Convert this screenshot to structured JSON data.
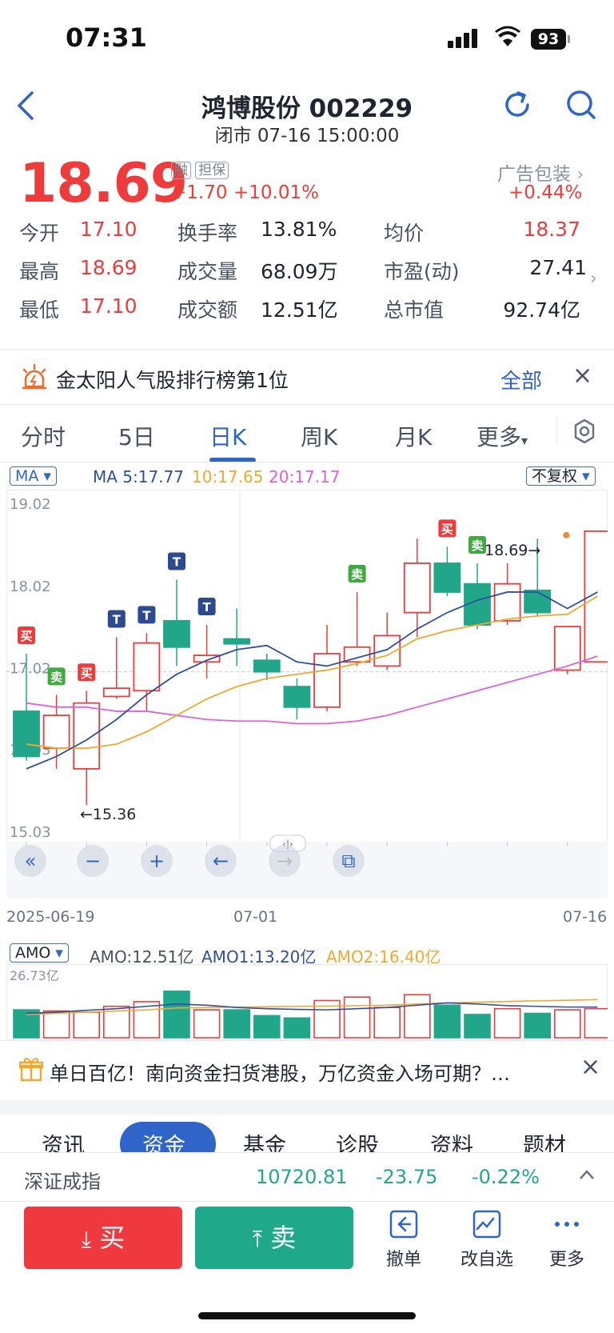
{
  "status": {
    "time": "07:31",
    "battery": "93"
  },
  "header": {
    "title": "鸿博股份 002229",
    "subtitle": "闭市 07-16 15:00:00"
  },
  "quote": {
    "price": "18.69",
    "tags": [
      "融",
      "担保"
    ],
    "change": "+1.70",
    "change_pct": "+10.01%",
    "sector_name": "广告包装",
    "sector_change": "+0.44%"
  },
  "stats": [
    {
      "label": "今开",
      "value": "17.10",
      "color": "#ee3b3b"
    },
    {
      "label": "换手率",
      "value": "13.81%",
      "color": "#1f2430"
    },
    {
      "label": "均价",
      "value": "18.37",
      "color": "#ee3b3b"
    },
    {
      "label": "最高",
      "value": "18.69",
      "color": "#ee3b3b"
    },
    {
      "label": "成交量",
      "value": "68.09万",
      "color": "#1f2430"
    },
    {
      "label": "市盈(动)",
      "value": "27.41",
      "color": "#1f2430"
    },
    {
      "label": "最低",
      "value": "17.10",
      "color": "#ee3b3b"
    },
    {
      "label": "成交额",
      "value": "12.51亿",
      "color": "#1f2430"
    },
    {
      "label": "总市值",
      "value": "92.74亿",
      "color": "#1f2430"
    }
  ],
  "banner": {
    "text": "金太阳人气股排行榜第1位",
    "action": "全部"
  },
  "tabs": [
    "分时",
    "5日",
    "日K",
    "周K",
    "月K",
    "更多"
  ],
  "active_tab": "日K",
  "ma_bar": {
    "selector": "MA",
    "ma5": "MA 5:17.77",
    "ma10": "10:17.65",
    "ma20": "20:17.17",
    "adjust": "不复权",
    "colors": {
      "ma5": "#2f4fa0",
      "ma10": "#f0a830",
      "ma20": "#e060e0"
    }
  },
  "chart_data": {
    "type": "candlestick",
    "y_ticks": [
      "19.02",
      "18.02",
      "17.02",
      "16.03",
      "15.03"
    ],
    "ylim": [
      15.03,
      19.02
    ],
    "x_labels": [
      "2025-06-19",
      "07-01",
      "07-16"
    ],
    "last_price_label": "18.69",
    "low_marker": "15.36",
    "candles": [
      {
        "o": 16.5,
        "c": 15.95,
        "h": 17.2,
        "l": 15.9
      },
      {
        "o": 16.05,
        "c": 16.45,
        "h": 16.7,
        "l": 15.8
      },
      {
        "o": 15.8,
        "c": 16.6,
        "h": 16.75,
        "l": 15.36
      },
      {
        "o": 16.68,
        "c": 16.78,
        "h": 17.4,
        "l": 16.65
      },
      {
        "o": 16.75,
        "c": 17.33,
        "h": 17.45,
        "l": 16.5
      },
      {
        "o": 17.6,
        "c": 17.28,
        "h": 18.1,
        "l": 17.05
      },
      {
        "o": 17.1,
        "c": 17.18,
        "h": 17.55,
        "l": 16.9
      },
      {
        "o": 17.38,
        "c": 17.32,
        "h": 17.75,
        "l": 17.05
      },
      {
        "o": 17.12,
        "c": 16.98,
        "h": 17.2,
        "l": 16.88
      },
      {
        "o": 16.8,
        "c": 16.55,
        "h": 16.9,
        "l": 16.4
      },
      {
        "o": 16.55,
        "c": 17.2,
        "h": 17.55,
        "l": 16.5
      },
      {
        "o": 17.1,
        "c": 17.28,
        "h": 17.95,
        "l": 17.05
      },
      {
        "o": 17.05,
        "c": 17.42,
        "h": 17.7,
        "l": 17.0
      },
      {
        "o": 17.7,
        "c": 18.3,
        "h": 18.6,
        "l": 17.4
      },
      {
        "o": 18.3,
        "c": 17.95,
        "h": 18.5,
        "l": 17.9
      },
      {
        "o": 18.05,
        "c": 17.55,
        "h": 18.3,
        "l": 17.5
      },
      {
        "o": 17.6,
        "c": 18.05,
        "h": 18.3,
        "l": 17.55
      },
      {
        "o": 17.97,
        "c": 17.7,
        "h": 18.6,
        "l": 17.65
      },
      {
        "o": 17.0,
        "c": 17.53,
        "h": 17.45,
        "l": 16.95
      },
      {
        "o": 17.1,
        "c": 18.69,
        "h": 18.69,
        "l": 17.1
      }
    ],
    "signals": [
      {
        "index": 0,
        "label": "买",
        "kind": "buy",
        "pos": "above"
      },
      {
        "index": 1,
        "label": "卖",
        "kind": "sell",
        "pos": "above"
      },
      {
        "index": 2,
        "label": "买",
        "kind": "buy",
        "pos": "above"
      },
      {
        "index": 3,
        "label": "T",
        "kind": "t",
        "pos": "above"
      },
      {
        "index": 4,
        "label": "T",
        "kind": "t",
        "pos": "above"
      },
      {
        "index": 5,
        "label": "T",
        "kind": "t",
        "pos": "above"
      },
      {
        "index": 6,
        "label": "T",
        "kind": "t",
        "pos": "above"
      },
      {
        "index": 11,
        "label": "卖",
        "kind": "sell",
        "pos": "above"
      },
      {
        "index": 14,
        "label": "买",
        "kind": "buy",
        "pos": "above"
      },
      {
        "index": 15,
        "label": "卖",
        "kind": "sell",
        "pos": "above"
      }
    ],
    "ma5": [
      15.8,
      15.95,
      16.15,
      16.4,
      16.7,
      16.95,
      17.12,
      17.25,
      17.3,
      17.1,
      17.05,
      17.15,
      17.25,
      17.5,
      17.7,
      17.85,
      17.95,
      17.95,
      17.75,
      17.95
    ],
    "ma10": [
      16.1,
      16.05,
      16.05,
      16.1,
      16.25,
      16.45,
      16.65,
      16.8,
      16.9,
      16.95,
      17.0,
      17.08,
      17.18,
      17.38,
      17.48,
      17.55,
      17.62,
      17.66,
      17.68,
      17.9
    ],
    "ma20": [
      16.6,
      16.55,
      16.55,
      16.5,
      16.5,
      16.45,
      16.4,
      16.38,
      16.38,
      16.35,
      16.35,
      16.38,
      16.45,
      16.55,
      16.65,
      16.75,
      16.85,
      16.95,
      17.05,
      17.17
    ]
  },
  "amo": {
    "selector": "AMO",
    "amo": "AMO:12.51亿",
    "amo1": "AMO1:13.20亿",
    "amo2": "AMO2:16.40亿",
    "top_label": "26.73亿",
    "volumes": [
      12.0,
      11.5,
      11.0,
      13.5,
      15.5,
      20.0,
      12.0,
      12.0,
      9.5,
      8.5,
      16.0,
      17.5,
      13.0,
      18.5,
      14.0,
      10.0,
      12.5,
      10.5,
      12.0,
      12.51
    ],
    "amo1_line": [
      10.5,
      11.0,
      11.8,
      12.5,
      13.5,
      14.5,
      14.0,
      13.0,
      12.5,
      12.2,
      12.0,
      12.5,
      13.0,
      14.0,
      15.0,
      14.5,
      13.8,
      13.5,
      13.2,
      13.2
    ],
    "amo2_line": [
      10.0,
      10.5,
      11.0,
      11.5,
      12.0,
      12.8,
      13.0,
      13.2,
      13.3,
      13.5,
      13.6,
      13.8,
      14.0,
      14.5,
      15.0,
      15.3,
      15.6,
      15.9,
      16.1,
      16.4
    ],
    "ymax": 26.73
  },
  "news": {
    "text": "单日百亿！南向资金扫货港股，万亿资金入场可期？…"
  },
  "subtabs": [
    "资讯",
    "资金",
    "基金",
    "诊股",
    "资料",
    "题材"
  ],
  "active_subtab": "资金",
  "index_bar": {
    "name": "深证成指",
    "value": "10720.81",
    "change": "-23.75",
    "change_pct": "-0.22%"
  },
  "bottom": {
    "buy": "买",
    "sell": "卖",
    "tools": [
      "撤单",
      "改自选",
      "更多"
    ]
  },
  "colors": {
    "up": "#ee3b3b",
    "down": "#22a68a",
    "accent": "#2f64c9"
  }
}
